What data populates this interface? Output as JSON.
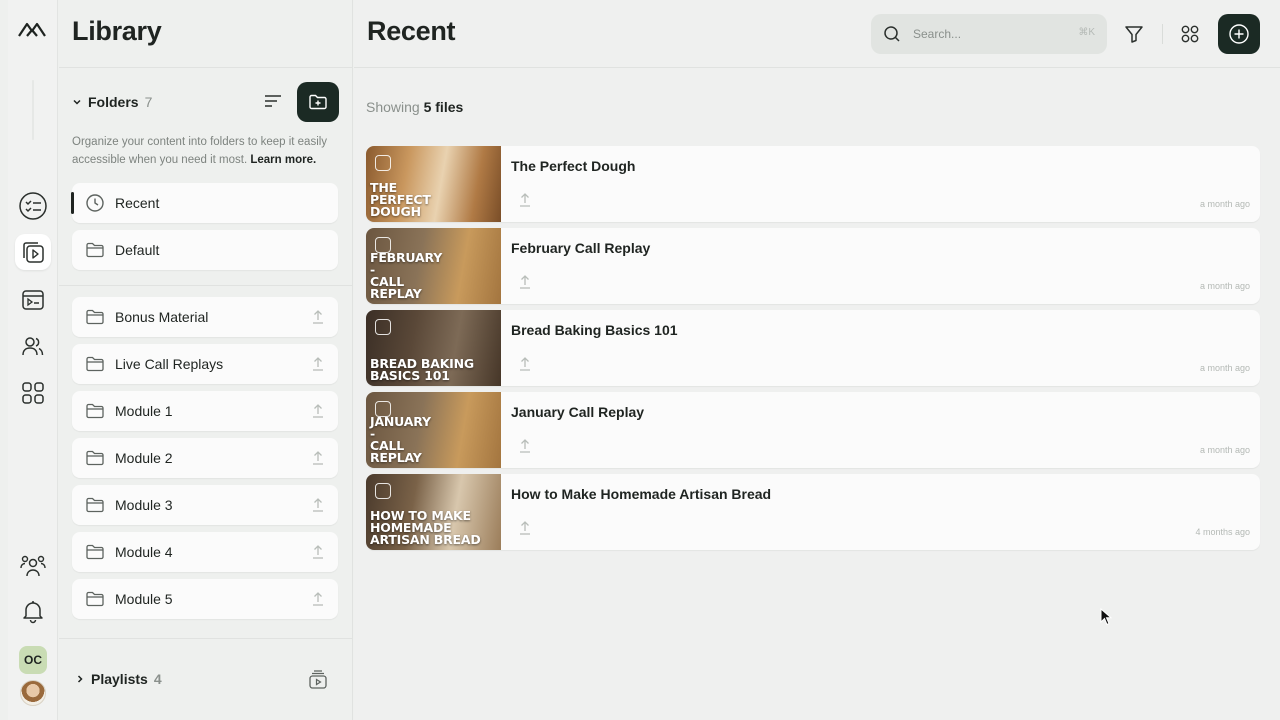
{
  "sidebar": {
    "folders_label": "Folders",
    "folders_count": "7",
    "description": "Organize your content into folders to keep it easily accessible when you need it most.",
    "learn_more": "Learn more.",
    "library_title": "Library",
    "pinned": [
      {
        "label": "Recent",
        "icon": "clock-icon"
      },
      {
        "label": "Default",
        "icon": "folder-icon"
      }
    ],
    "folders": [
      {
        "label": "Bonus Material"
      },
      {
        "label": "Live Call Replays"
      },
      {
        "label": "Module 1"
      },
      {
        "label": "Module 2"
      },
      {
        "label": "Module 3"
      },
      {
        "label": "Module 4"
      },
      {
        "label": "Module 5"
      }
    ],
    "playlists_label": "Playlists",
    "playlists_count": "4"
  },
  "rail": {
    "avatar_initials": "OC"
  },
  "main": {
    "title": "Recent",
    "search_placeholder": "Search...",
    "search_shortcut": "⌘K",
    "showing_prefix": "Showing",
    "showing_count": "5 files",
    "files": [
      {
        "title": "The Perfect Dough",
        "thumb_text": "THE\nPERFECT\nDOUGH",
        "time": "a month ago"
      },
      {
        "title": "February Call Replay",
        "thumb_text": "FEBRUARY\n-\nCALL\nREPLAY",
        "time": "a month ago"
      },
      {
        "title": "Bread Baking Basics 101",
        "thumb_text": "BREAD BAKING\nBASICS 101",
        "time": "a month ago"
      },
      {
        "title": "January Call Replay",
        "thumb_text": "JANUARY\n-\nCALL\nREPLAY",
        "time": "a month ago"
      },
      {
        "title": "How to Make Homemade Artisan Bread",
        "thumb_text": "HOW TO MAKE\nHOMEMADE\nARTISAN BREAD",
        "time": "4 months ago"
      }
    ]
  },
  "colors": {
    "accent_dark": "#1b2a24",
    "avatar_green": "#c9dcb4"
  }
}
